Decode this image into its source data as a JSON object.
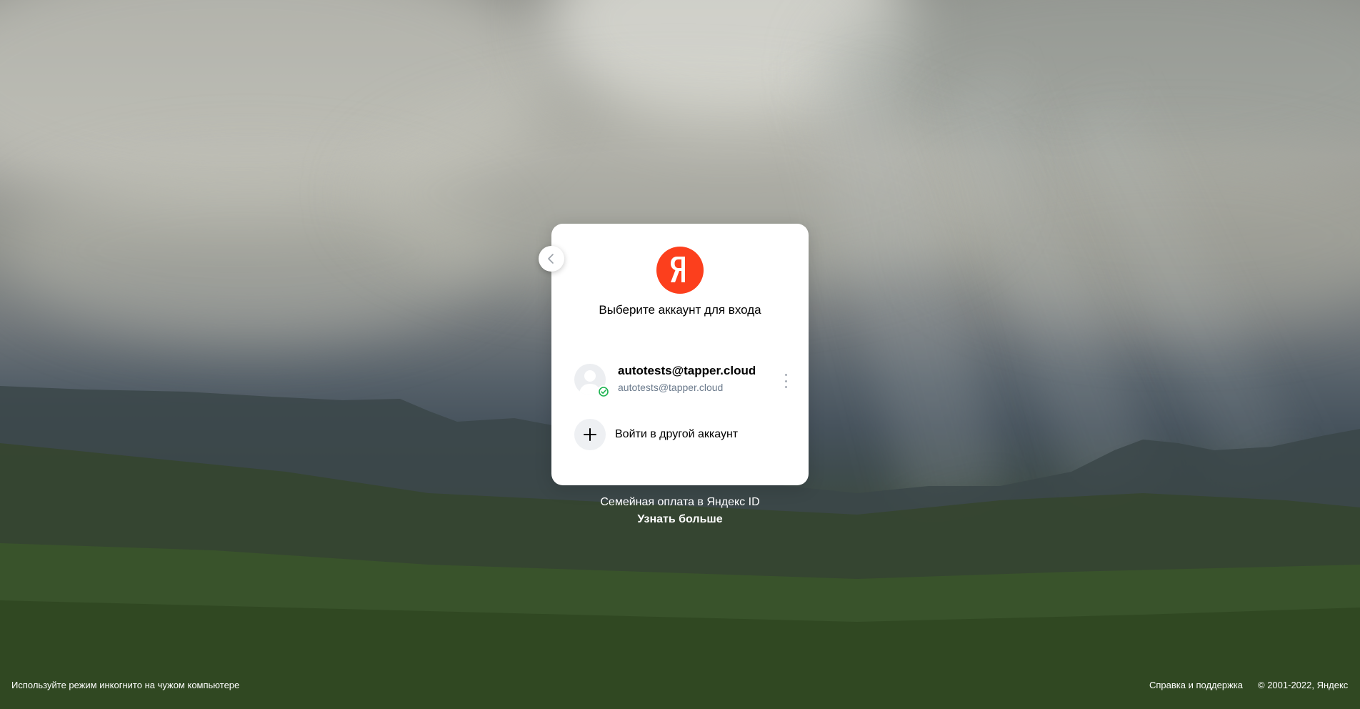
{
  "background": {
    "description_icon": "landscape-photo"
  },
  "back_button": {
    "icon": "chevron-left-icon"
  },
  "logo": {
    "letter": "Я",
    "color": "#fc3f1d"
  },
  "card": {
    "title": "Выберите аккаунт для входа"
  },
  "account": {
    "login": "autotests@tapper.cloud",
    "email": "autotests@tapper.cloud",
    "status_icon": "check-circle-icon",
    "status_color": "#1bb34f",
    "menu_icon": "more-vertical-icon"
  },
  "add_account": {
    "label": "Войти в другой аккаунт",
    "icon": "plus-icon"
  },
  "promo": {
    "text": "Семейная оплата в Яндекс ID",
    "link": "Узнать больше"
  },
  "footer": {
    "incognito_hint": "Используйте режим инкогнито на чужом компьютере",
    "help_link": "Справка и поддержка",
    "copyright": "© 2001-2022, Яндекс"
  }
}
